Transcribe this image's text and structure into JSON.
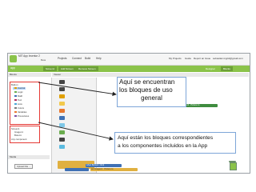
{
  "app": {
    "title": "MIT App Inventor 2",
    "subtitle": "Beta",
    "menu": [
      "Projects",
      "Connect",
      "Build",
      "Help"
    ],
    "top_right": [
      "My Projects",
      "Guide",
      "Report an Issue",
      "sebastian.ingrid@gmail.com"
    ]
  },
  "toolbar": {
    "project_name": "app",
    "buttons": [
      "Screen1",
      "Add Screen",
      "Remove Screen"
    ],
    "tabs": [
      "Designer",
      "Blocks"
    ]
  },
  "panels": {
    "blocks_header": "Blocks",
    "viewer_header": "Viewer"
  },
  "builtin": {
    "label": "Built-in",
    "items": [
      "Control",
      "Logic",
      "Math",
      "Text",
      "Lists",
      "Colors",
      "Variables",
      "Procedures"
    ]
  },
  "components": {
    "label": "Screen1",
    "items": [
      "Imagen1",
      "Boton1",
      "Any component"
    ]
  },
  "media": {
    "header": "Media",
    "button": "Upload File ..."
  },
  "workspace": {
    "block_texts": [
      "when Boton1 .Click",
      "do",
      "set Imagen1 . Picture to"
    ]
  },
  "callouts": {
    "general_blocks": [
      "Aquí se encuentran",
      "los bloques de uso",
      "general"
    ],
    "component_blocks": [
      "Aquí están los bloques correspondientes",
      "a los componentes incluidos en la App"
    ]
  },
  "colors": {
    "accent_green": "#8bc34a",
    "highlight_red": "#e53935",
    "callout_border": "#7ea6d8"
  }
}
